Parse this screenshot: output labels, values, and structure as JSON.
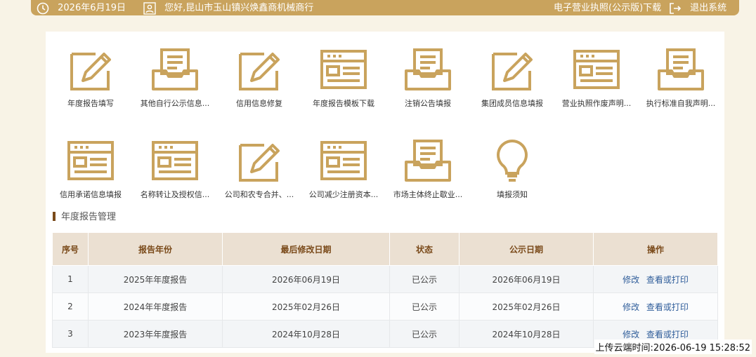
{
  "header": {
    "date": "2026年6月19日",
    "greeting": "您好,昆山市玉山镇兴焕鑫商机械商行",
    "license_download": "电子营业执照(公示版)下载",
    "logout": "退出系统"
  },
  "icons": [
    {
      "label": "年度报告填写",
      "icon": "pencil-doc"
    },
    {
      "label": "其他自行公示信息...",
      "icon": "inbox-doc"
    },
    {
      "label": "信用信息修复",
      "icon": "pencil-doc"
    },
    {
      "label": "年度报告模板下载",
      "icon": "form-doc"
    },
    {
      "label": "注销公告填报",
      "icon": "inbox-doc"
    },
    {
      "label": "集团成员信息填报",
      "icon": "pencil-doc"
    },
    {
      "label": "营业执照作废声明...",
      "icon": "form-doc"
    },
    {
      "label": "执行标准自我声明...",
      "icon": "inbox-doc"
    },
    {
      "label": "信用承诺信息填报",
      "icon": "form-doc"
    },
    {
      "label": "名称转让及授权信...",
      "icon": "form-doc"
    },
    {
      "label": "公司和农专合并、...",
      "icon": "pencil-doc"
    },
    {
      "label": "公司减少注册资本...",
      "icon": "form-doc"
    },
    {
      "label": "市场主体终止歇业...",
      "icon": "inbox-doc"
    },
    {
      "label": "填报须知",
      "icon": "lightbulb"
    }
  ],
  "section": {
    "title": "年度报告管理"
  },
  "table": {
    "headers": [
      "序号",
      "报告年份",
      "最后修改日期",
      "状态",
      "公示日期",
      "操作"
    ],
    "rows": [
      {
        "no": "1",
        "year": "2025年年度报告",
        "modified": "2026年06月19日",
        "status": "已公示",
        "published": "2026年06月19日",
        "op_edit": "修改",
        "op_view": "查看或打印"
      },
      {
        "no": "2",
        "year": "2024年年度报告",
        "modified": "2025年02月26日",
        "status": "已公示",
        "published": "2025年02月26日",
        "op_edit": "修改",
        "op_view": "查看或打印"
      },
      {
        "no": "3",
        "year": "2023年年度报告",
        "modified": "2024年10月28日",
        "status": "已公示",
        "published": "2024年10月28日",
        "op_edit": "修改",
        "op_view": "查看或打印"
      }
    ]
  },
  "footer": {
    "upload_time": "上传云端时间:2026-06-19 15:28:52"
  },
  "colors": {
    "gold": "#c9a35d",
    "header_bg": "#ebe0d2",
    "link": "#2f5d9a"
  }
}
